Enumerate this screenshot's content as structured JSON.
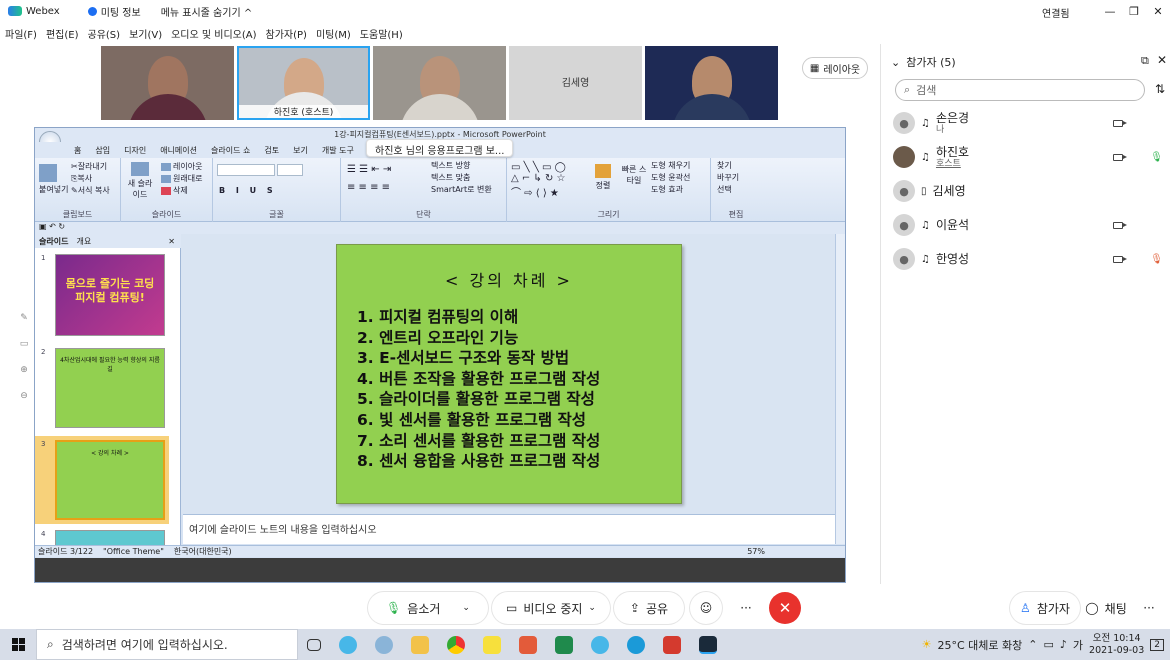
{
  "app": {
    "name": "Webex",
    "meeting_info": "미팅 정보",
    "menu_toggle": "메뉴 표시줄 숨기기 ^",
    "connected": "연결됨",
    "win_controls": [
      "—",
      "❐",
      "✕"
    ]
  },
  "menubar": [
    "파일(F)",
    "편집(E)",
    "공유(S)",
    "보기(V)",
    "오디오 및 비디오(A)",
    "참가자(P)",
    "미팅(M)",
    "도움말(H)"
  ],
  "video_tiles": [
    {
      "name": ""
    },
    {
      "name": "하진호 (호스트)"
    },
    {
      "name": ""
    },
    {
      "name": "김세영"
    },
    {
      "name": ""
    }
  ],
  "layout_button": "레이아웃",
  "share_tooltip": "하진호 님의 응용프로그램 보...",
  "ppt": {
    "title": "1강-피지컬컴퓨팅(E센서보드).pptx - Microsoft PowerPoint",
    "tabs": [
      "홈",
      "삽입",
      "디자인",
      "애니메이션",
      "슬라이드 쇼",
      "검토",
      "보기",
      "개발 도구"
    ],
    "ribbon_groups": [
      "클립보드",
      "슬라이드",
      "글꼴",
      "단락",
      "그리기",
      "편집"
    ],
    "ribbon_buttons": {
      "paste": "붙여넣기",
      "cut": "잘라내기",
      "copy": "복사",
      "format_painter": "서식 복사",
      "new_slide": "새 슬라이드",
      "layout": "레이아웃",
      "reset": "원래대로",
      "delete": "삭제",
      "text_direction": "텍스트 방향",
      "text_align": "텍스트 맞춤",
      "smartart": "SmartArt로 변환",
      "arrange": "정렬",
      "quick_styles": "빠른 스타일",
      "shape_fill": "도형 채우기",
      "shape_outline": "도형 윤곽선",
      "shape_effects": "도형 효과",
      "find": "찾기",
      "replace": "바꾸기",
      "select": "선택"
    },
    "panel_tabs": [
      "슬라이드",
      "개요"
    ],
    "thumbs": [
      {
        "num": "1",
        "text": "몸으로 즐기는 코딩\n피지컬 컴퓨팅!"
      },
      {
        "num": "2",
        "text": "4차산업시대에 필요한 능력 향상의 지름길"
      },
      {
        "num": "3",
        "text": "< 강의 차례 >"
      },
      {
        "num": "4",
        "text": ""
      }
    ],
    "slide": {
      "title": "< 강의 차례 >",
      "items": [
        "1. 피지컬 컴퓨팅의 이해",
        "2. 엔트리 오프라인 기능",
        "3. E-센서보드 구조와 동작 방법",
        "4. 버튼 조작을 활용한 프로그램 작성",
        "5. 슬라이더를 활용한 프로그램 작성",
        "6. 빛 센서를 활용한 프로그램 작성",
        "7. 소리 센서를 활용한 프로그램 작성",
        "8. 센서 융합을 사용한 프로그램 작성"
      ]
    },
    "notes_placeholder": "여기에 슬라이드 노트의 내용을 입력하십시오",
    "status": {
      "slide_pos": "슬라이드 3/122",
      "theme": "\"Office Theme\"",
      "language": "한국어(대한민국)",
      "zoom": "57%"
    }
  },
  "participants": {
    "header": "참가자 (5)",
    "search_placeholder": "검색",
    "list": [
      {
        "name": "손은경",
        "sub": "나"
      },
      {
        "name": "하진호",
        "sub": "호스트"
      },
      {
        "name": "김세영",
        "sub": ""
      },
      {
        "name": "이윤석",
        "sub": ""
      },
      {
        "name": "한영성",
        "sub": ""
      }
    ]
  },
  "controls": {
    "mute": "음소거",
    "video": "비디오 중지",
    "share": "공유",
    "more": "···",
    "end": "✕",
    "participants_btn": "참가자",
    "chat_btn": "채팅",
    "more_right": "···"
  },
  "taskbar": {
    "search": "검색하려면 여기에 입력하십시오.",
    "weather": "25°C  대체로 화창",
    "ime": "가",
    "time": "오전 10:14",
    "date": "2021-09-03",
    "notif": "2"
  }
}
